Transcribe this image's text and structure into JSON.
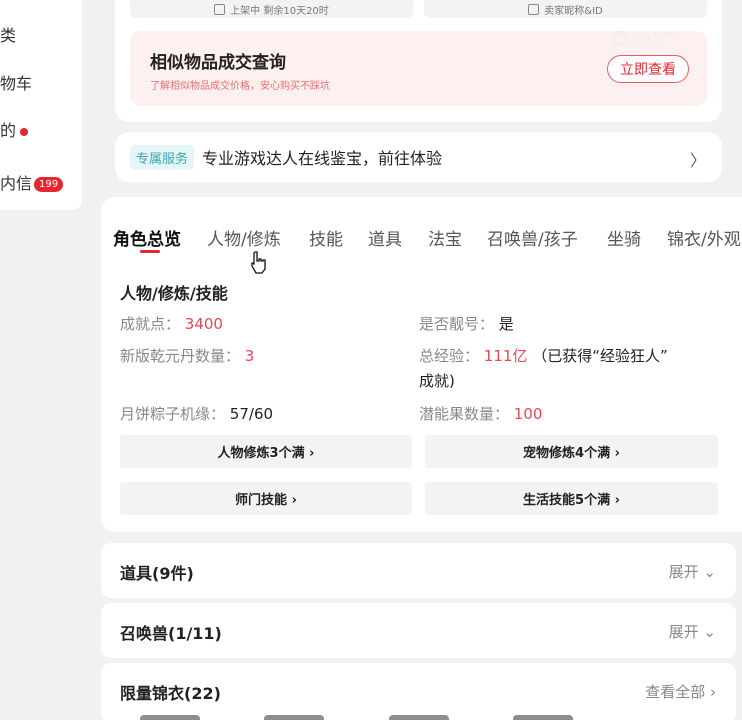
{
  "sidebar": {
    "items": [
      {
        "label": "类"
      },
      {
        "label": "物车"
      },
      {
        "label": "的"
      },
      {
        "label": "内信",
        "badge": "199"
      }
    ]
  },
  "top_card": {
    "left_btn": "上架中 剩余10天20时",
    "right_btn": "卖家昵称&ID",
    "promo_title": "相似物品成交查询",
    "promo_sub": "了解相似物品成交价格，安心购买不踩坑",
    "promo_button": "立即查看",
    "watermark": "Ⓞ100™"
  },
  "service": {
    "tag": "专属服务",
    "text": "专业游戏达人在线鉴宝，前往体验",
    "chevron": "〉"
  },
  "tabs": [
    "角色总览",
    "人物/修炼",
    "技能",
    "道具",
    "法宝",
    "召唤兽/孩子",
    "坐骑",
    "锦衣/外观"
  ],
  "overview": {
    "section_title": "人物/修炼/技能",
    "rows": [
      {
        "label": "成就点：",
        "value": "3400"
      },
      {
        "label": "是否靓号：",
        "value": "是"
      },
      {
        "label": "新版乾元丹数量：",
        "value": "3"
      },
      {
        "label": "总经验：",
        "value": "111亿",
        "suffix": "（已获得“经验狂人”",
        "suffix2": "成就)"
      },
      {
        "label": "月饼粽子机缘：",
        "value": "57/60"
      },
      {
        "label": "潜能果数量：",
        "value": "100"
      }
    ],
    "buttons": [
      "人物修炼3个满 ›",
      "宠物修炼4个满 ›",
      "师门技能 ›",
      "生活技能5个满 ›"
    ]
  },
  "panels": [
    {
      "title": "道具(9件)",
      "action": "展开"
    },
    {
      "title": "召唤兽(1/11)",
      "action": "展开"
    },
    {
      "title": "限量锦衣(22)",
      "action": "查看全部"
    }
  ],
  "colors": {
    "accent": "#e8262f",
    "service_tag": "#3aa7b0"
  }
}
